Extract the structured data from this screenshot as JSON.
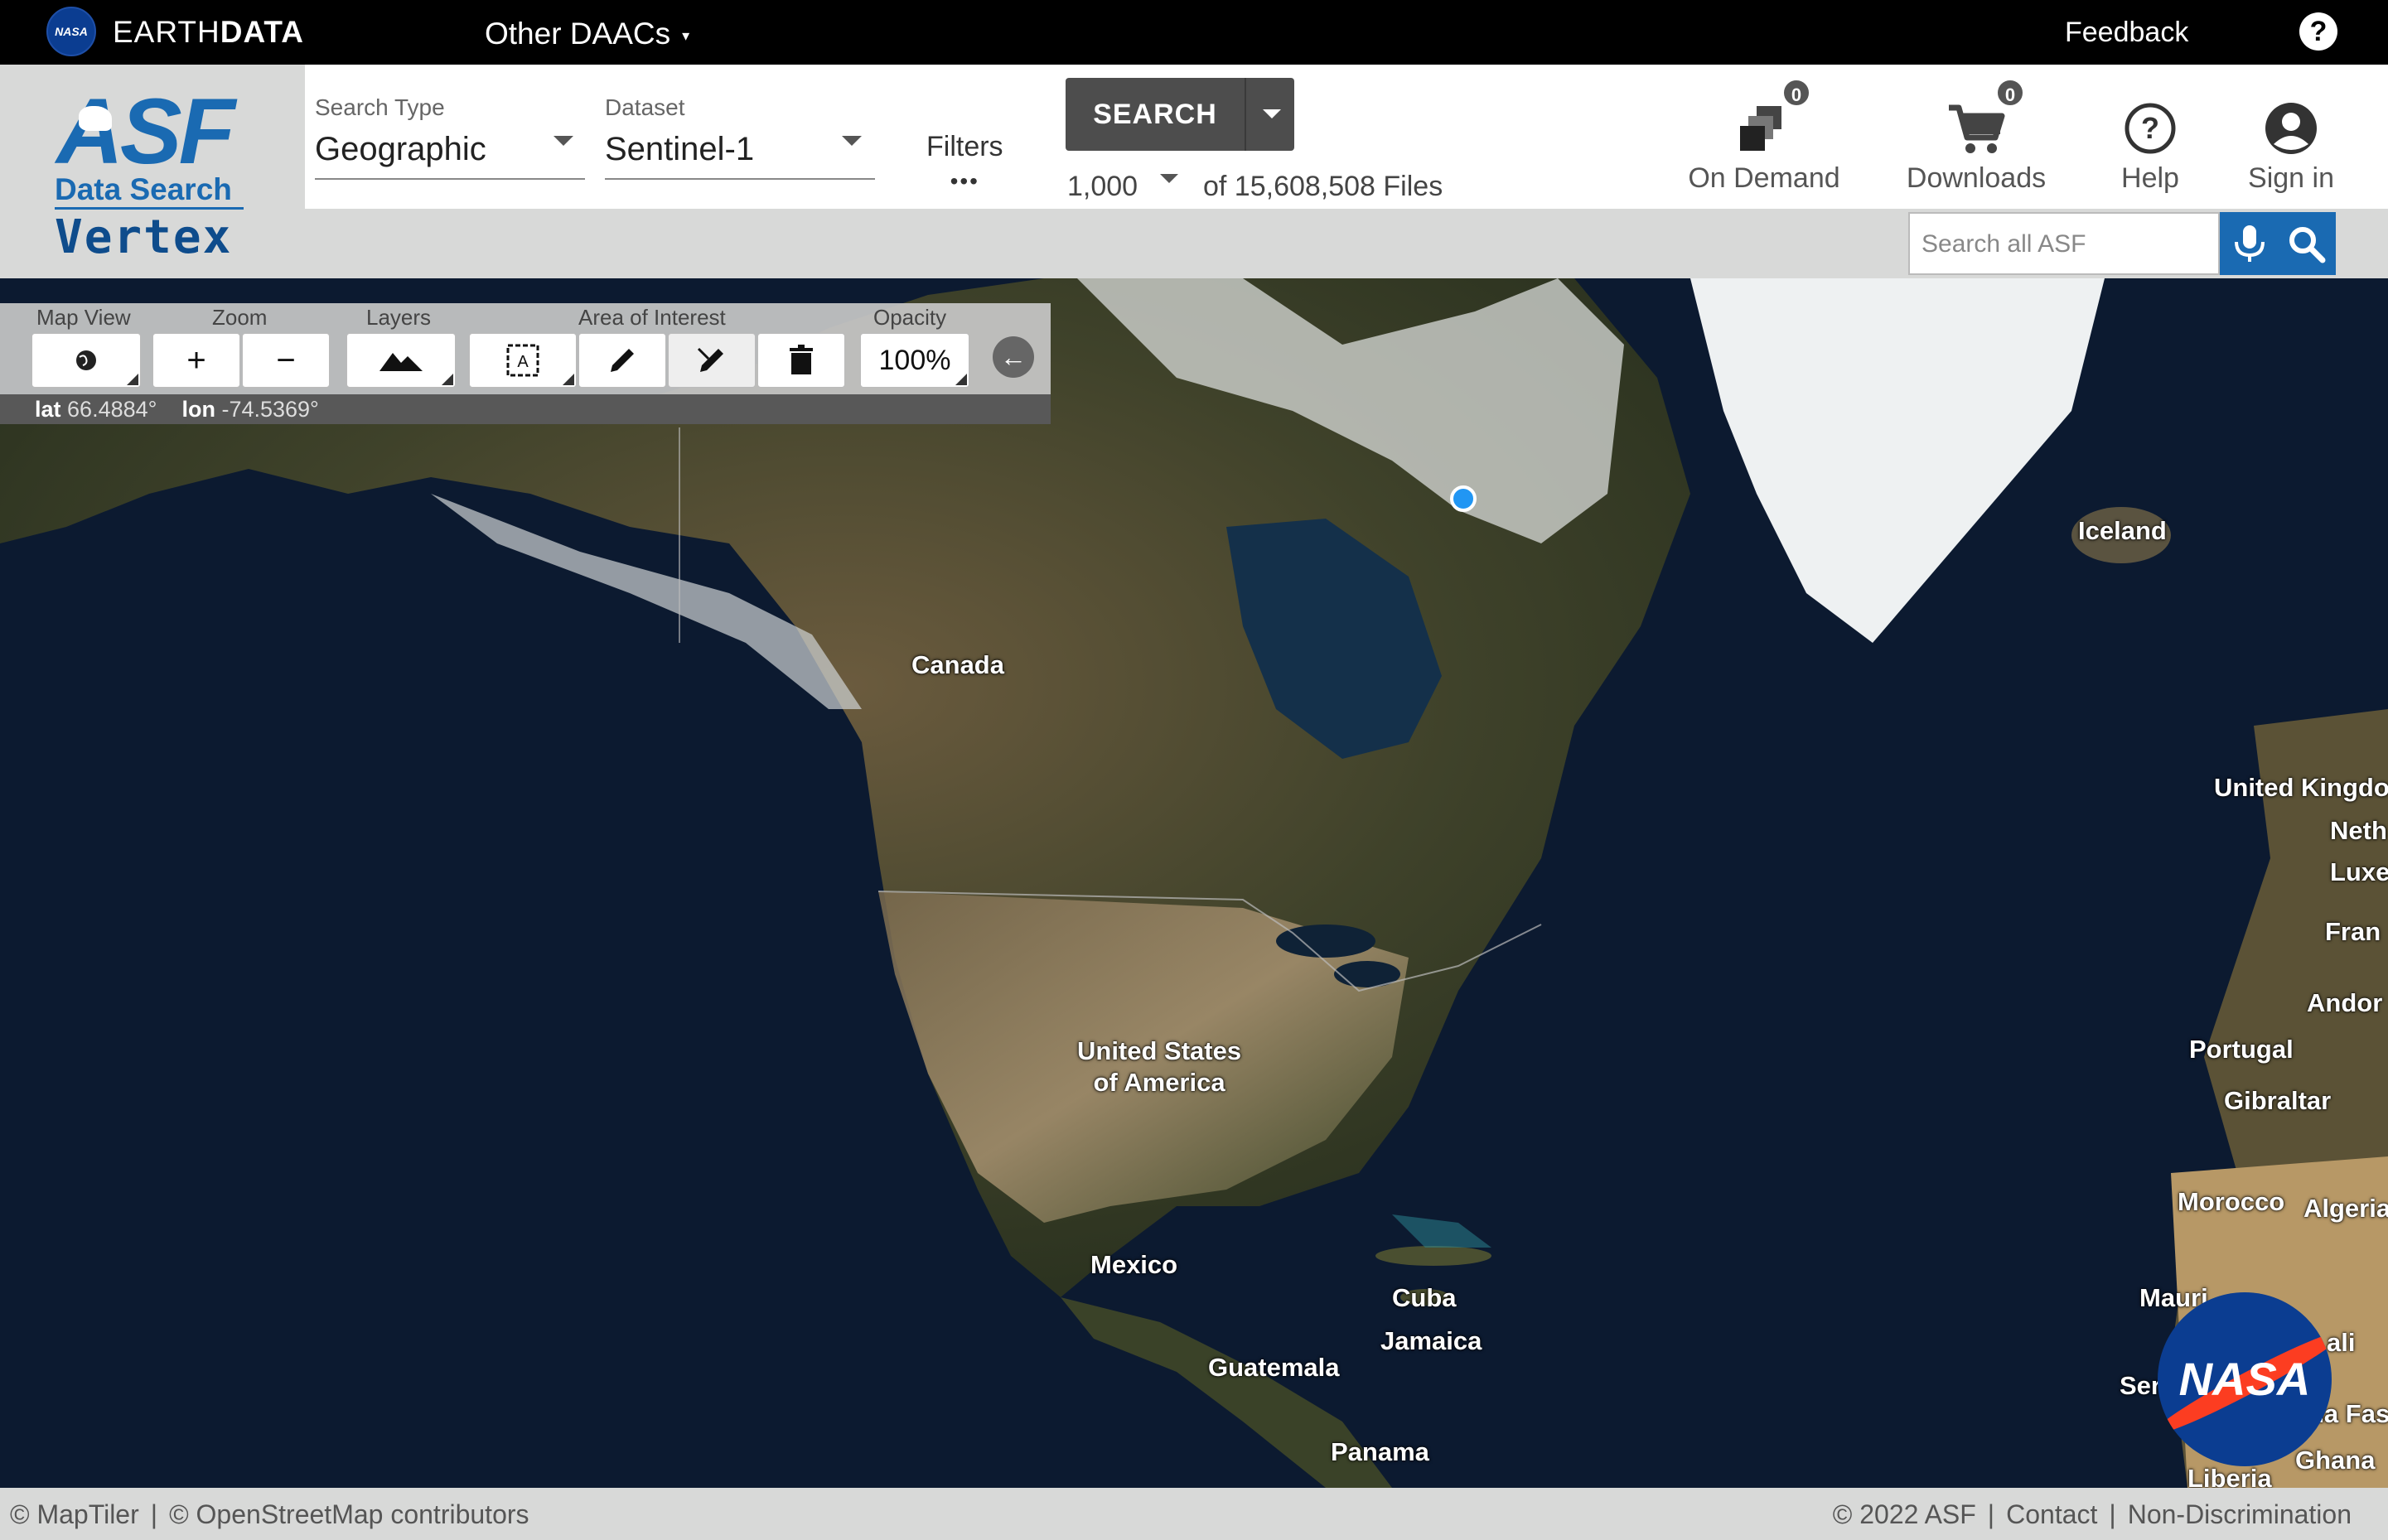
{
  "earthdata_bar": {
    "nasa_logo_text": "NASA",
    "title_light": "EARTH",
    "title_bold": "DATA",
    "other_daacs": "Other DAACs",
    "feedback": "Feedback",
    "help_icon": "question-circle-icon"
  },
  "asf_logo": {
    "asf": "ASF",
    "data_search": "Data Search",
    "vertex": "Vertex"
  },
  "search_type": {
    "label": "Search Type",
    "value": "Geographic"
  },
  "dataset": {
    "label": "Dataset",
    "value": "Sentinel-1"
  },
  "filters": {
    "label": "Filters",
    "dots": "•••"
  },
  "search_button": {
    "label": "SEARCH"
  },
  "results": {
    "count": "1,000",
    "of_text": "of 15,608,508 Files"
  },
  "top_actions": {
    "on_demand": {
      "label": "On Demand",
      "badge": "0"
    },
    "downloads": {
      "label": "Downloads",
      "badge": "0"
    },
    "help": {
      "label": "Help"
    },
    "sign_in": {
      "label": "Sign in"
    }
  },
  "search_all": {
    "placeholder": "Search all ASF"
  },
  "toolbar": {
    "map_view_label": "Map View",
    "zoom_label": "Zoom",
    "zoom_in": "+",
    "zoom_out": "−",
    "layers_label": "Layers",
    "aoi_label": "Area of Interest",
    "opacity_label": "Opacity",
    "opacity_value": "100%"
  },
  "coords": {
    "lat_label": "lat",
    "lat_value": "66.4884°",
    "lon_label": "lon",
    "lon_value": "-74.5369°"
  },
  "map_labels": {
    "canada": "Canada",
    "iceland": "Iceland",
    "usa_line1": "United States",
    "usa_line2": "of America",
    "mexico": "Mexico",
    "cuba": "Cuba",
    "jamaica": "Jamaica",
    "guatemala": "Guatemala",
    "panama": "Panama",
    "uk": "United Kingdo",
    "neth": "Neth",
    "luxe": "Luxe",
    "fran": "Fran",
    "andor": "Andor",
    "portugal": "Portugal",
    "gibraltar": "Gibraltar",
    "morocco": "Morocco",
    "algeria": "Algeria",
    "mauri": "Mauri",
    "mali": "ali",
    "sen": "Ser",
    "ina_fas": "na Fas",
    "ghana": "Ghana",
    "liberia": "Liberia"
  },
  "nasa_badge": "NASA",
  "footer": {
    "maptiler": "© MapTiler",
    "osm": "© OpenStreetMap contributors",
    "copyright": "© 2022 ASF",
    "contact": "Contact",
    "non_discrimination": "Non-Discrimination"
  }
}
